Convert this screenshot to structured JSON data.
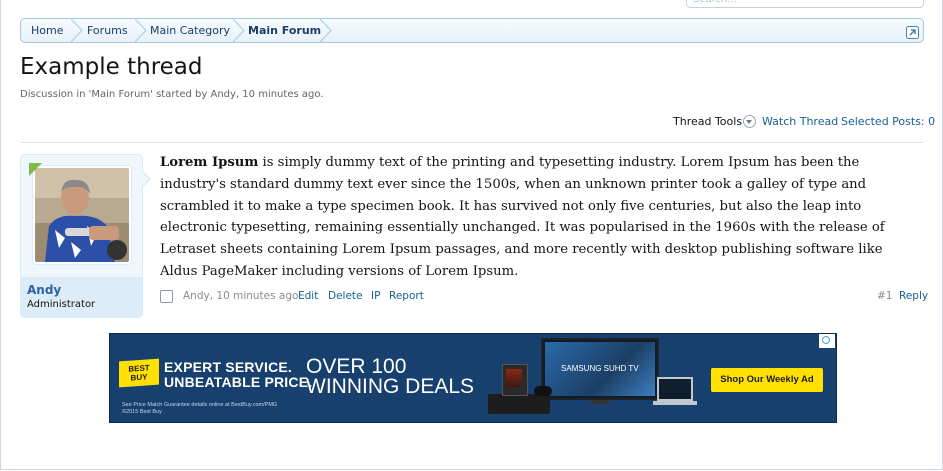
{
  "search": {
    "placeholder": "Search..."
  },
  "breadcrumb": {
    "items": [
      {
        "label": "Home"
      },
      {
        "label": "Forums"
      },
      {
        "label": "Main Category"
      },
      {
        "label": "Main Forum"
      }
    ]
  },
  "thread": {
    "title": "Example thread",
    "meta": "Discussion in 'Main Forum' started by Andy, 10 minutes ago."
  },
  "toolbar": {
    "thread_tools": "Thread Tools",
    "watch_thread": "Watch Thread",
    "selected_posts": "Selected Posts: 0"
  },
  "post": {
    "author": "Andy",
    "user_title": "Administrator",
    "body_bold": "Lorem Ipsum",
    "body_text": " is simply dummy text of the printing and typesetting industry. Lorem Ipsum has been the industry's standard dummy text ever since the 1500s, when an unknown printer took a galley of type and scrambled it to make a type specimen book. It has survived not only five centuries, but also the leap into electronic typesetting, remaining essentially unchanged. It was popularised in the 1960s with the release of Letraset sheets containing Lorem Ipsum passages, and more recently with desktop publishing software like Aldus PageMaker including versions of Lorem Ipsum.",
    "date": "Andy, 10 minutes ago",
    "actions": {
      "edit": "Edit",
      "delete": "Delete",
      "ip": "IP",
      "report": "Report"
    },
    "number": "#1",
    "reply": "Reply"
  },
  "ad": {
    "logo": "BEST BUY",
    "line1": "EXPERT SERVICE.",
    "line2": "UNBEATABLE PRICE.",
    "big1": "OVER 100",
    "big2": "WINNING DEALS",
    "tv_brand": "SAMSUNG SUHD TV",
    "cta": "Shop Our Weekly Ad",
    "fine_print_1": "See Price Match Guarantee details online at BestBuy.com/PMG",
    "fine_print_2": "©2015 Best Buy"
  },
  "colors": {
    "link": "#176093",
    "username": "#2b64a0",
    "breadcrumb_border": "#a5cae4",
    "ad_bg": "#17406e",
    "ad_yellow": "#ffe000",
    "online": "#7fb94a"
  }
}
